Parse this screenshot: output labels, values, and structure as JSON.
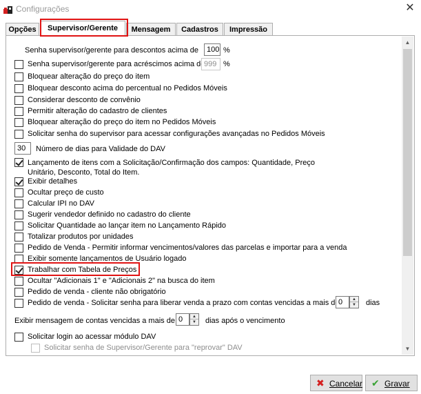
{
  "window": {
    "title": "Configurações"
  },
  "tabs": [
    {
      "label": "Opções"
    },
    {
      "label": "Supervisor/Gerente"
    },
    {
      "label": "Mensagem"
    },
    {
      "label": "Cadastros"
    },
    {
      "label": "Impressão"
    }
  ],
  "fields": {
    "senha_desconto": {
      "label": "Senha supervisor/gerente para descontos acima de",
      "value": "100",
      "unit": "%"
    },
    "senha_acrescimo": {
      "label": "Senha supervisor/gerente para acréscimos acima de",
      "value": "999",
      "unit": "%"
    },
    "dias_validade": {
      "value": "30",
      "label": "Número de dias para Validade do DAV"
    },
    "contas_vencidas_prazo": {
      "value": "0",
      "unit": "dias"
    },
    "mensagem_vencidas": {
      "label": "Exibir mensagem de contas vencidas a mais de",
      "value": "0",
      "suffix": "dias após o vencimento"
    }
  },
  "options": [
    {
      "label": "Bloquear alteração do preço do item",
      "checked": false
    },
    {
      "label": "Bloquear desconto acima do percentual no Pedidos Móveis",
      "checked": false
    },
    {
      "label": "Considerar desconto de convênio",
      "checked": false
    },
    {
      "label": "Permitir alteração do cadastro de clientes",
      "checked": false
    },
    {
      "label": "Bloquear alteração do preço do item no Pedidos Móveis",
      "checked": false
    },
    {
      "label": "Solicitar senha do supervisor para acessar configurações avançadas no Pedidos Móveis",
      "checked": false
    }
  ],
  "lancamento": {
    "label": "Lançamento de itens com a Solicitação/Confirmação  dos campos: Quantidade, Preço Unitário, Desconto, Total do Item.",
    "checked": true
  },
  "options2": [
    {
      "label": "Exibir detalhes",
      "checked": true
    },
    {
      "label": "Ocultar preço de custo",
      "checked": false
    },
    {
      "label": "Calcular IPI no DAV",
      "checked": false
    },
    {
      "label": "Sugerir vendedor definido no cadastro do cliente",
      "checked": false
    },
    {
      "label": "Solicitar Quantidade ao lançar item no Lançamento Rápido",
      "checked": false
    },
    {
      "label": "Totalizar produtos por unidades",
      "checked": false
    },
    {
      "label": "Pedido de Venda - Permitir informar vencimentos/valores das parcelas e importar para a venda",
      "checked": false
    },
    {
      "label": "Exibir somente lançamentos de Usuário logado",
      "checked": false
    },
    {
      "label": "Trabalhar com Tabela de Preços",
      "checked": true
    },
    {
      "label": "Ocultar \"Adicionais 1\" e \"Adicionais 2\" na busca do item",
      "checked": false
    },
    {
      "label": "Pedido de venda - cliente não obrigatório",
      "checked": false
    },
    {
      "label": "Pedido de venda - Solicitar senha para liberar venda a prazo com contas vencidas a mais de",
      "checked": false
    }
  ],
  "login_modulo": {
    "label": "Solicitar login ao acessar módulo DAV",
    "checked": false
  },
  "reprovar": {
    "label": "Solicitar senha de Supervisor/Gerente para \"reprovar\" DAV",
    "checked": false
  },
  "buttons": {
    "cancel": "Cancelar",
    "save": "Gravar"
  },
  "colors": {
    "highlight": "#e01212",
    "save_icon": "#3aa335",
    "cancel_icon": "#d42020"
  }
}
